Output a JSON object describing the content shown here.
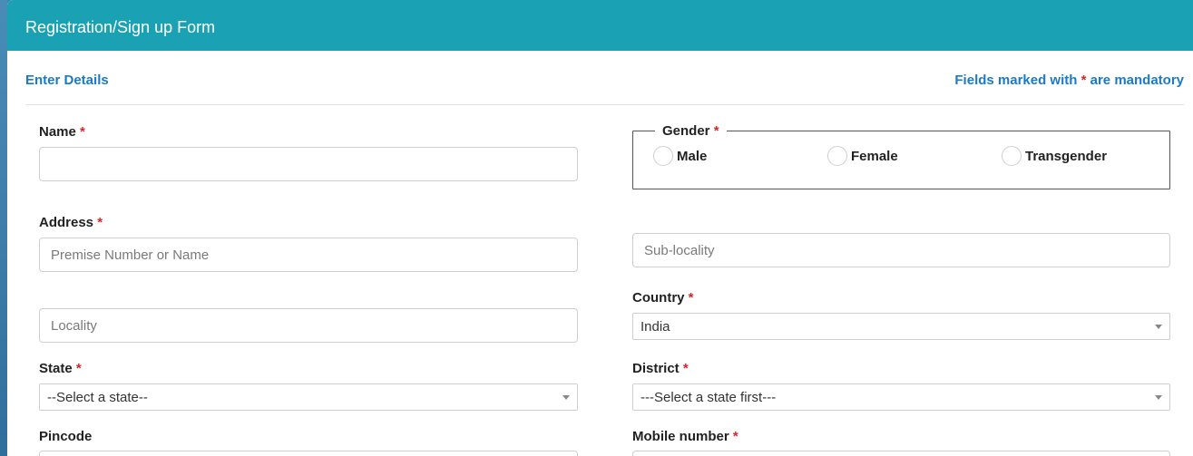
{
  "form": {
    "title": "Registration/Sign up Form",
    "enter_details": "Enter Details",
    "mandatory_prefix": "Fields marked with",
    "mandatory_star": "*",
    "mandatory_suffix": "are mandatory"
  },
  "fields": {
    "name": {
      "label": "Name",
      "required": "*",
      "value": ""
    },
    "gender": {
      "label": "Gender",
      "required": "*",
      "options": [
        "Male",
        "Female",
        "Transgender"
      ]
    },
    "address": {
      "label": "Address",
      "required": "*"
    },
    "premise": {
      "placeholder": "Premise Number or Name"
    },
    "sublocality": {
      "placeholder": "Sub-locality"
    },
    "locality": {
      "placeholder": "Locality"
    },
    "country": {
      "label": "Country",
      "required": "*",
      "selected": "India"
    },
    "state": {
      "label": "State",
      "required": "*",
      "selected": "--Select a state--"
    },
    "district": {
      "label": "District",
      "required": "*",
      "selected": "---Select a state first---"
    },
    "pincode": {
      "label": "Pincode"
    },
    "mobile": {
      "label": "Mobile number",
      "required": "*"
    }
  },
  "colors": {
    "header_bg": "#1ba1b4",
    "link_blue": "#1a7ac8",
    "required_red": "#d9262c"
  }
}
